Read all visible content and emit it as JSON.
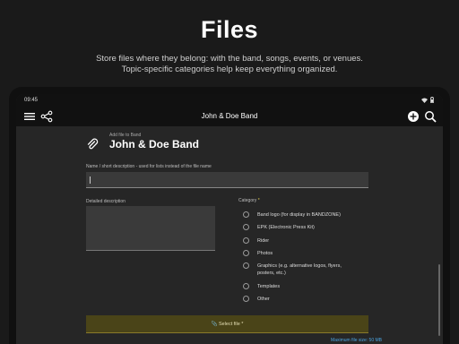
{
  "promo": {
    "title": "Files",
    "subtitle_line1": "Store files where they belong: with the band, songs, events, or venues.",
    "subtitle_line2": "Topic-specific categories help keep everything organized."
  },
  "status_bar": {
    "time": "09:45"
  },
  "toolbar": {
    "title": "John & Doe Band"
  },
  "form": {
    "overline": "Add file to Band",
    "heading": "John & Doe Band",
    "name_label": "Name / short description - used for lists instead of the file name",
    "name_value": "",
    "description_label": "Detailed description",
    "category_label": "Category",
    "category_required": "*",
    "categories": [
      "Band logo (for display in BANDZONE)",
      "EPK (Electronic Press Kit)",
      "Rider",
      "Photos",
      "Graphics (e.g. alternative logos, flyers, posters, etc.)",
      "Templates",
      "Other"
    ],
    "select_file_label": "Select file *",
    "max_size": "Maximum file size: 50 MB"
  },
  "colors": {
    "background": "#1a1a1a",
    "screen": "#262626",
    "accent_button": "#4a4418",
    "link": "#4aa3df"
  }
}
